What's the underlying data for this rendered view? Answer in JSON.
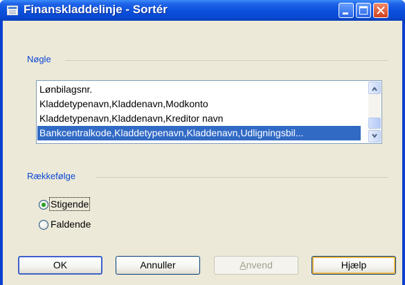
{
  "window": {
    "title": "Finanskladdelinje - Sortér"
  },
  "key_group": {
    "label": "Nøgle",
    "items": [
      {
        "label": "Lønbilagsnr.",
        "selected": false
      },
      {
        "label": "Kladdetypenavn,Kladdenavn,Modkonto",
        "selected": false
      },
      {
        "label": "Kladdetypenavn,Kladdenavn,Kreditor navn",
        "selected": false
      },
      {
        "label": "Bankcentralkode,Kladdetypenavn,Kladdenavn,Udligningsbil...",
        "selected": true
      }
    ]
  },
  "order_group": {
    "label": "Rækkefølge",
    "options": [
      {
        "label": "Stigende",
        "checked": true
      },
      {
        "label": "Faldende",
        "checked": false
      }
    ]
  },
  "buttons": {
    "ok": "OK",
    "cancel": "Annuller",
    "apply_rest": "nvend",
    "apply_accel": "A",
    "help": "Hjælp"
  },
  "colors": {
    "titlebar": "#0a50dc",
    "selection": "#316ac5",
    "group_label": "#0a46d5",
    "dialog_bg": "#ece9d8"
  }
}
